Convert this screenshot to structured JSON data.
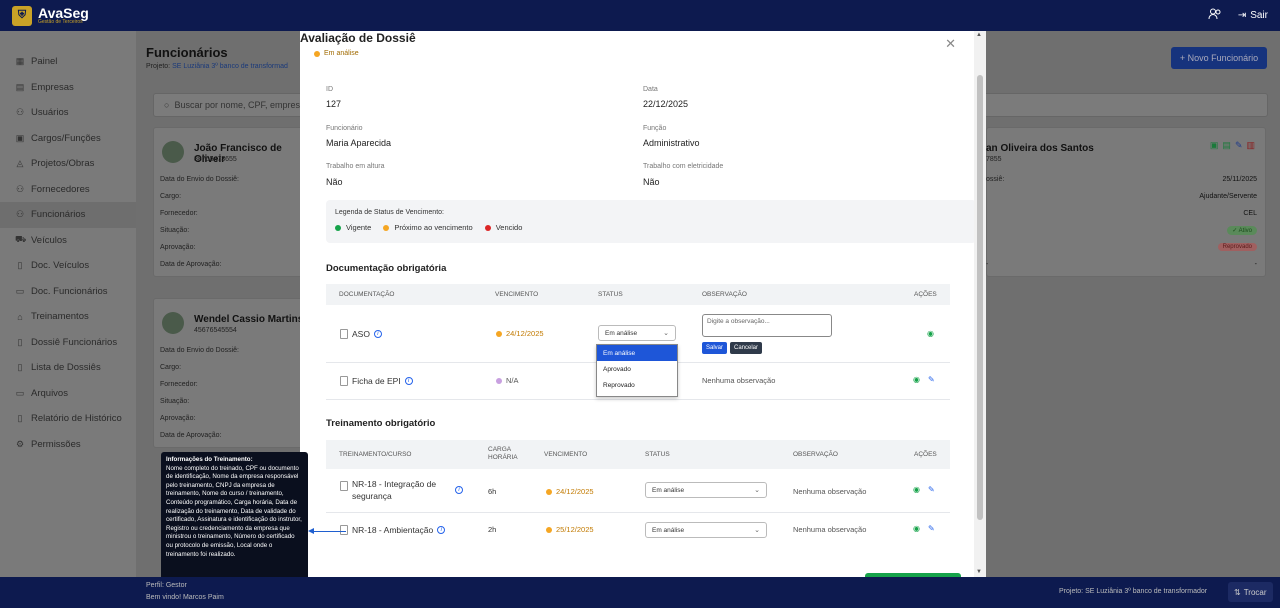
{
  "app": {
    "name": "AvaSeg",
    "subtitle": "Gestão de Terceiros",
    "logout": "Sair"
  },
  "sidebar": {
    "items": [
      {
        "label": "Painel",
        "icon": "grid-icon"
      },
      {
        "label": "Empresas",
        "icon": "building-icon"
      },
      {
        "label": "Usuários",
        "icon": "users-icon"
      },
      {
        "label": "Cargos/Funções",
        "icon": "briefcase-icon"
      },
      {
        "label": "Projetos/Obras",
        "icon": "construction-icon"
      },
      {
        "label": "Fornecedores",
        "icon": "users-icon"
      },
      {
        "label": "Funcionários",
        "icon": "users-icon"
      },
      {
        "label": "Veículos",
        "icon": "truck-icon"
      },
      {
        "label": "Doc. Veículos",
        "icon": "document-icon"
      },
      {
        "label": "Doc. Funcionários",
        "icon": "folder-icon"
      },
      {
        "label": "Treinamentos",
        "icon": "graduation-icon"
      },
      {
        "label": "Dossiê Funcionários",
        "icon": "document-icon"
      },
      {
        "label": "Lista de Dossiês",
        "icon": "document-icon"
      },
      {
        "label": "Arquivos",
        "icon": "folder-icon"
      },
      {
        "label": "Relatório de Histórico",
        "icon": "document-icon"
      },
      {
        "label": "Permissões",
        "icon": "gear-icon"
      }
    ]
  },
  "page": {
    "title": "Funcionários",
    "project_label": "Projeto:",
    "project": "SE Luziânia 3º banco de transformad",
    "new_button": "+ Novo Funcionário",
    "search_placeholder": "Buscar por nome, CPF, empresa,"
  },
  "cards": [
    {
      "name": "João Francisco de Oliveir",
      "doc": "88765473655",
      "rows": [
        "Data do Envio do Dossiê:",
        "Cargo:",
        "Fornecedor:",
        "Situação:",
        "Aprovação:",
        "Data de Aprovação:"
      ]
    },
    {
      "name": "Wendel Cassio Martins",
      "doc": "45676545554",
      "rows": [
        "Data do Envio do Dossiê:",
        "Cargo:",
        "Fornecedor:",
        "Situação:",
        "Aprovação:",
        "Data de Aprovação:"
      ]
    }
  ],
  "right_card": {
    "name": "an Oliveira dos Santos",
    "doc": "7855",
    "envio_label": "ossiê:",
    "date": "25/11/2025",
    "cargo": "Ajudante/Servente",
    "fornecedor": "CEL",
    "situacao": "✓ Ativo",
    "aprovacao": "Reprovado",
    "data_aprovacao": "-",
    "dash": "-"
  },
  "tooltip": {
    "title": "Informações do Treinamento:",
    "text": "Nome completo do treinado, CPF ou documento de identificação, Nome da empresa responsável pelo treinamento, CNPJ da empresa de treinamento, Nome do curso / treinamento, Conteúdo programático, Carga horária, Data de realização do treinamento, Data de validade do certificado, Assinatura e identificação do instrutor, Registro ou credenciamento da empresa que ministrou o treinamento, Número do certificado ou protocolo de emissão, Local onde o treinamento foi realizado."
  },
  "footer": {
    "profile": "Perfil: Gestor",
    "welcome": "Bem vindo! Marcos Paim",
    "project": "Projeto: SE Luziânia 3º banco de transformador",
    "switch": "Trocar"
  },
  "modal": {
    "title": "Avaliação de Dossiê",
    "status": "Em análise",
    "fields": {
      "id_label": "ID",
      "id": "127",
      "data_label": "Data",
      "data": "22/12/2025",
      "func_label": "Funcionário",
      "func": "Maria Aparecida",
      "funcao_label": "Função",
      "funcao": "Administrativo",
      "altura_label": "Trabalho em altura",
      "altura": "Não",
      "eletr_label": "Trabalho com eletricidade",
      "eletr": "Não"
    },
    "legend": {
      "title": "Legenda de Status de Vencimento:",
      "items": [
        "Vigente",
        "Próximo ao vencimento",
        "Vencido"
      ]
    },
    "doc_section": "Documentação obrigatória",
    "doc_headers": [
      "DOCUMENTAÇÃO",
      "VENCIMENTO",
      "STATUS",
      "OBSERVAÇÃO",
      "AÇÕES"
    ],
    "doc_rows": [
      {
        "name": "ASO",
        "venc": "24/12/2025",
        "status": "Em análise"
      },
      {
        "name": "Ficha de EPI",
        "venc": "N/A",
        "obs": "Nenhuma observação"
      }
    ],
    "obs_placeholder": "Digite a observação...",
    "save": "Salvar",
    "cancel": "Cancelar",
    "status_options": [
      "Em análise",
      "Aprovado",
      "Reprovado"
    ],
    "train_section": "Treinamento obrigatório",
    "train_headers": [
      "TREINAMENTO/CURSO",
      "CARGA HORÁRIA",
      "VENCIMENTO",
      "STATUS",
      "OBSERVAÇÃO",
      "AÇÕES"
    ],
    "train_rows": [
      {
        "name": "NR-18 - Integração de segurança",
        "carga": "6h",
        "venc": "24/12/2025",
        "status": "Em análise",
        "obs": "Nenhuma observação"
      },
      {
        "name": "NR-18 - Ambientação",
        "carga": "2h",
        "venc": "25/12/2025",
        "status": "Em análise",
        "obs": "Nenhuma observação"
      }
    ]
  },
  "colors": {
    "navy": "#0d1a4f",
    "gold": "#c9a227",
    "blue": "#2563eb",
    "green": "#16a34a",
    "orange": "#f5a623",
    "red": "#dc2626"
  }
}
